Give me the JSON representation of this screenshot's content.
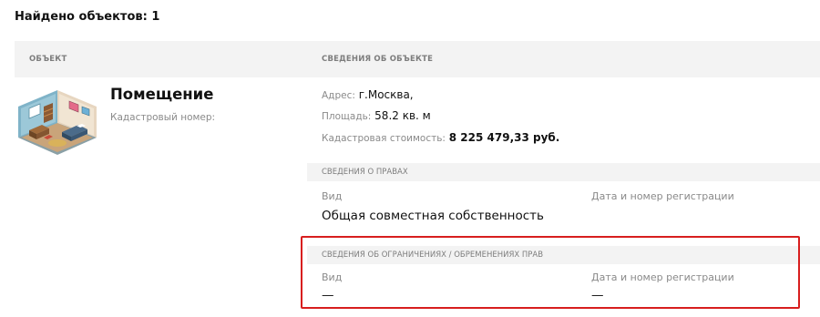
{
  "results": {
    "found_label": "Найдено объектов: 1"
  },
  "table": {
    "col_object": "ОБЪЕКТ",
    "col_info": "СВЕДЕНИЯ ОБ ОБЪЕКТЕ"
  },
  "object": {
    "title": "Помещение",
    "cadastral_label": "Кадастровый номер:",
    "image_icon": "room-illustration-icon"
  },
  "details": {
    "address_label": "Адрес:",
    "address_value": "г.Москва,",
    "area_label": "Площадь:",
    "area_value": "58.2 кв. м",
    "cost_label": "Кадастровая стоимость:",
    "cost_value": "8 225 479,33 руб."
  },
  "rights": {
    "section_title": "СВЕДЕНИЯ О ПРАВАХ",
    "type_label": "Вид",
    "type_value": "Общая совместная собственность",
    "reg_label": "Дата и номер регистрации",
    "reg_value": ""
  },
  "restrictions": {
    "section_title": "СВЕДЕНИЯ ОБ ОГРАНИЧЕНИЯХ / ОБРЕМЕНЕНИЯХ ПРАВ",
    "type_label": "Вид",
    "type_value": "—",
    "reg_label": "Дата и номер регистрации",
    "reg_value": "—"
  },
  "colors": {
    "highlight": "#d81e1e",
    "header_bg": "#f3f3f3"
  }
}
